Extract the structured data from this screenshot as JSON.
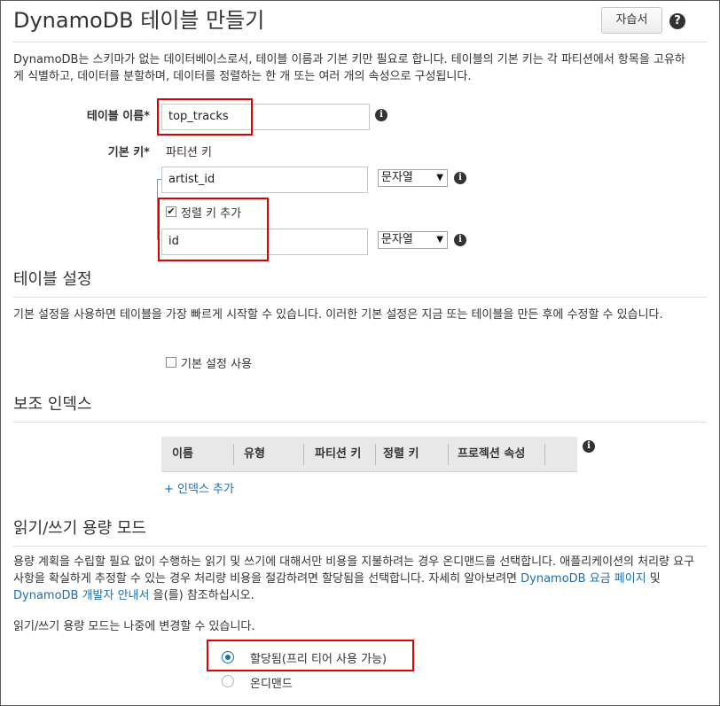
{
  "header": {
    "title": "DynamoDB 테이블 만들기",
    "help_button": "자습서"
  },
  "intro": "DynamoDB는 스키마가 없는 데이터베이스로서, 테이블 이름과 기본 키만 필요로 합니다. 테이블의 기본 키는 각 파티션에서 항목을 고유하게 식별하고, 데이터를 분할하며, 데이터를 정렬하는 한 개 또는 여러 개의 속성으로 구성됩니다.",
  "table_name": {
    "label": "테이블 이름*",
    "value": "top_tracks"
  },
  "primary_key": {
    "label": "기본 키*",
    "partition_label": "파티션 키",
    "partition_value": "artist_id",
    "partition_type": "문자열",
    "add_sort_key_label": "정렬 키 추가",
    "add_sort_key_checked": true,
    "sort_value": "id",
    "sort_type": "문자열"
  },
  "table_settings": {
    "title": "테이블 설정",
    "description": "기본 설정을 사용하면 테이블을 가장 빠르게 시작할 수 있습니다. 이러한 기본 설정은 지금 또는 테이블을 만든 후에 수정할 수 있습니다.",
    "use_default_label": "기본 설정 사용",
    "use_default_checked": false
  },
  "secondary_indexes": {
    "title": "보조 인덱스",
    "columns": [
      "이름",
      "유형",
      "파티션 키",
      "정렬 키",
      "프로젝션 속성"
    ],
    "add_index_link": "+ 인덱스 추가"
  },
  "capacity_mode": {
    "title": "읽기/쓰기 용량 모드",
    "desc_part1": "용량 계획을 수립할 필요 없이 수행하는 읽기 및 쓰기에 대해서만 비용을 지불하려는 경우 온디맨드를 선택합니다. 애플리케이션의 처리량 요구 사항을 확실하게 추정할 수 있는 경우 처리량 비용을 절감하려면 할당됨을 선택합니다. 자세히 알아보려면 ",
    "link_pricing": "DynamoDB 요금 페이지",
    "desc_and": " 및 ",
    "link_guide": "DynamoDB 개발자 안내서",
    "desc_tail": " 을(를) 참조하십시오.",
    "change_note": "읽기/쓰기 용량 모드는 나중에 변경할 수 있습니다.",
    "options": [
      {
        "label": "할당됨(프리 티어 사용 가능)",
        "selected": true
      },
      {
        "label": "온디맨드",
        "selected": false
      }
    ]
  },
  "colors": {
    "highlight": "#e00000",
    "link": "#1b6fb5",
    "table_header_bg": "#e8e8e8"
  }
}
